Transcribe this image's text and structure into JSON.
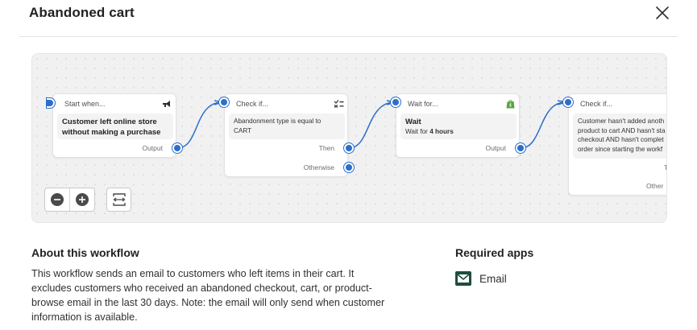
{
  "modal": {
    "title": "Abandoned cart",
    "close_icon": "close-icon"
  },
  "workflow": {
    "nodes": [
      {
        "header": "Start when...",
        "icon": "megaphone-icon",
        "body_line1": "Customer left online store",
        "body_line2": "without making a purchase",
        "output_label": "Output"
      },
      {
        "header": "Check if...",
        "icon": "checklist-icon",
        "body_line1": "Abandonment type is equal to",
        "body_line2": "CART",
        "then_label": "Then",
        "otherwise_label": "Otherwise"
      },
      {
        "header": "Wait for...",
        "icon": "shopify-bag-icon",
        "body_title": "Wait",
        "body_prefix": "Wait for ",
        "body_value": "4 hours",
        "output_label": "Output"
      },
      {
        "header": "Check if...",
        "body_lines": [
          "Customer hasn't added anoth",
          "product to cart AND hasn't sta",
          "checkout AND hasn't complet",
          "order since starting the workf"
        ],
        "then_label": "T",
        "otherwise_label": "Other"
      }
    ],
    "controls": {
      "zoom_out_icon": "zoom-out-icon",
      "zoom_in_icon": "zoom-in-icon",
      "fit_icon": "fit-to-screen-icon"
    },
    "accent_color": "#2c6ecb"
  },
  "about": {
    "title": "About this workflow",
    "description": "This workflow sends an email to customers who left items in their cart. It excludes customers who received an abandoned checkout, cart, or product-browse email in the last 30 days. Note: the email will only send when customer information is available."
  },
  "required_apps": {
    "title": "Required apps",
    "apps": [
      {
        "name": "Email",
        "icon": "email-app-icon",
        "color": "#1e4d3f"
      }
    ]
  }
}
